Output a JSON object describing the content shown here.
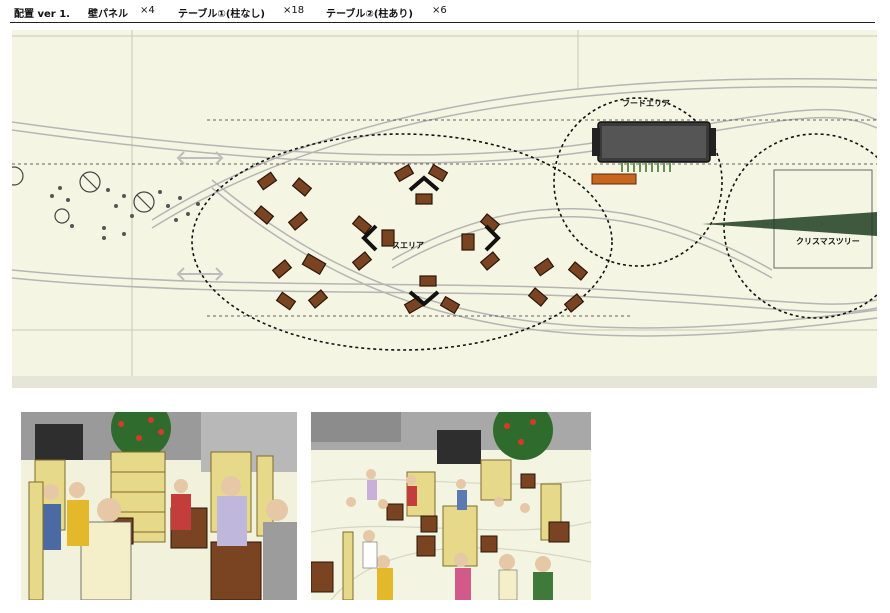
{
  "header": {
    "layout_version": "配置 ver 1.",
    "wall_panel_label": "壁パネル",
    "wall_panel_count": "×4",
    "table1_label": "テーブル①(柱なし)",
    "table1_count": "×18",
    "table2_label": "テーブル②(柱あり)",
    "table2_count": "×6"
  },
  "plan": {
    "area_seating_label": "スエリア",
    "area_food_label": "フードエリア",
    "area_tree_label": "クリスマスツリー"
  },
  "colors": {
    "plan_bg": "#f5f5e3",
    "table_brown": "#7a4422",
    "food_counter": "#c8651e",
    "truck": "#3a3a3a",
    "rail": "#b5b5b5",
    "header_text": "#111111"
  },
  "icons": {
    "arrow_double": "double-arrow-icon",
    "no_entry_symbol": "no-entry-icon"
  }
}
